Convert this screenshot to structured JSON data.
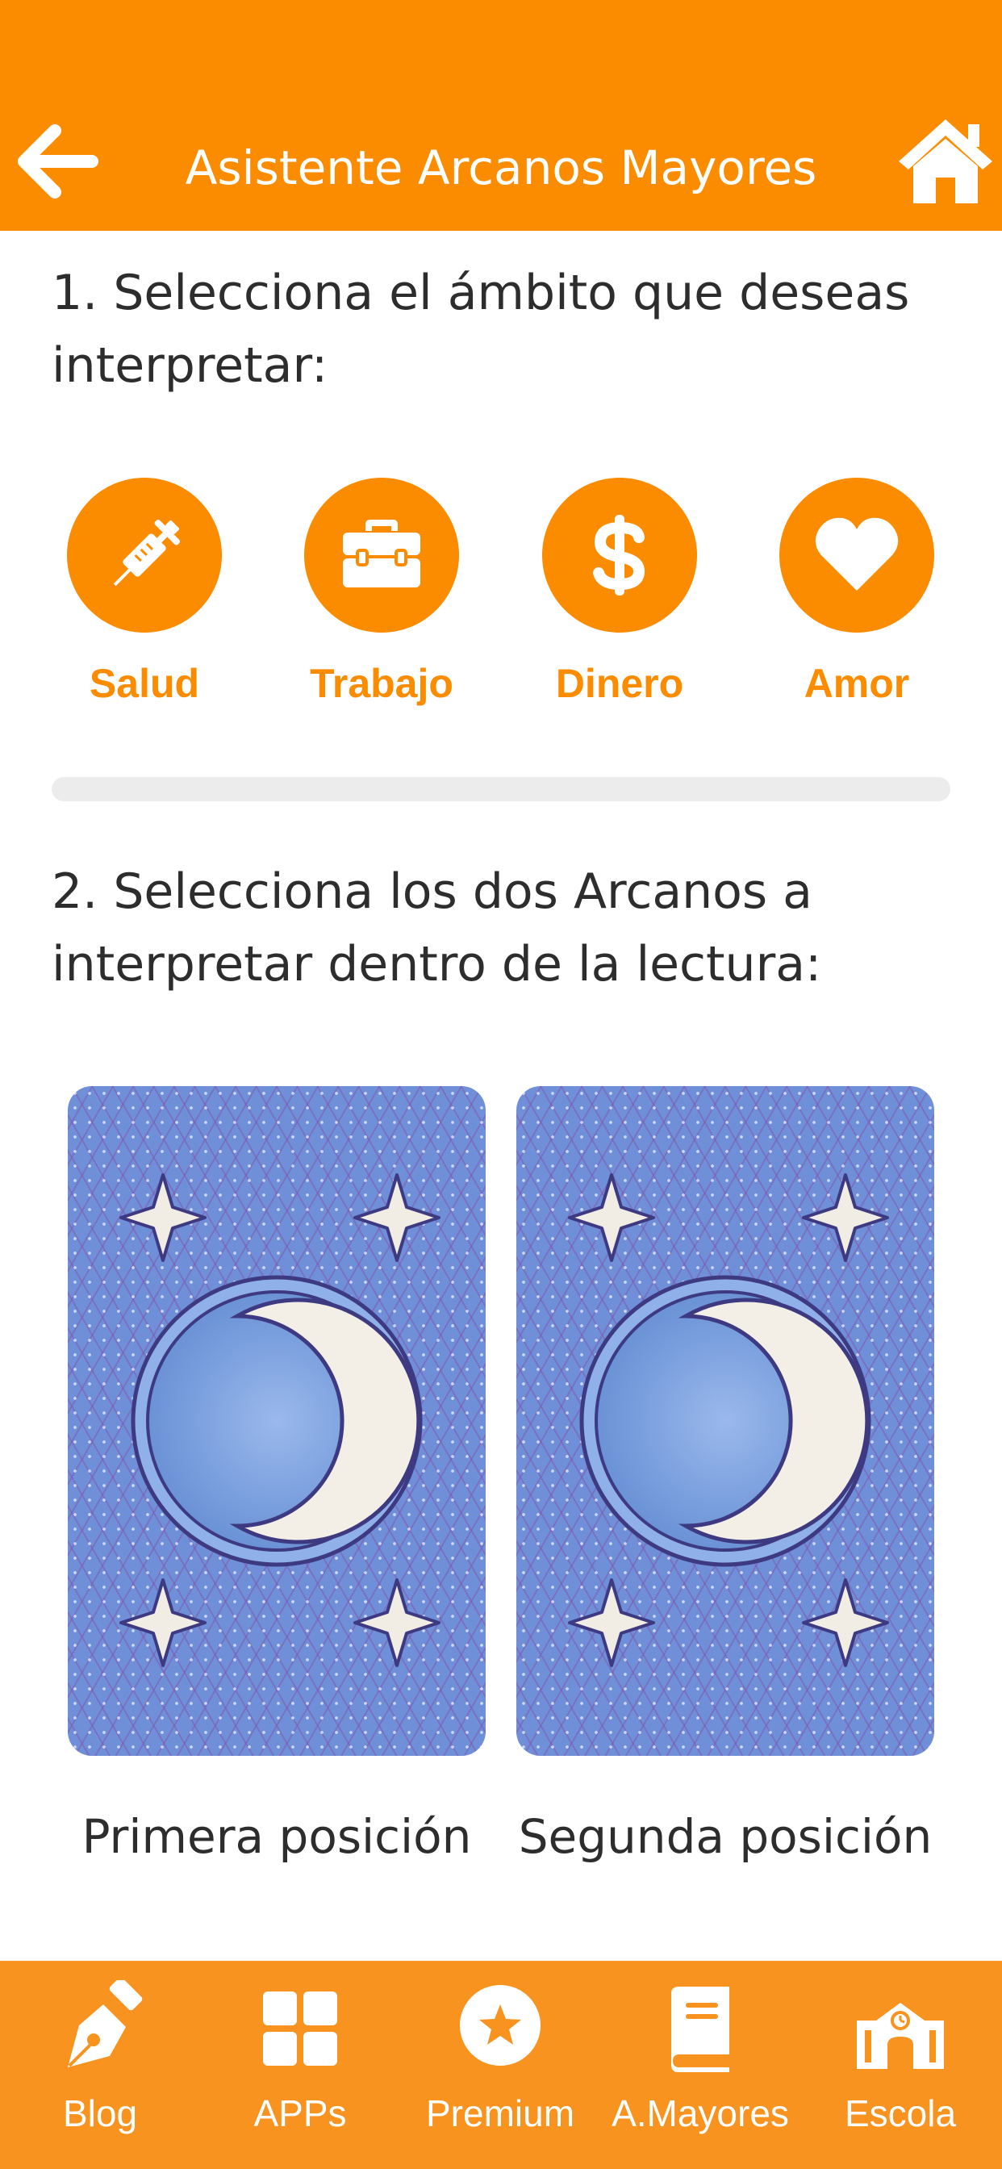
{
  "header": {
    "title": "Asistente Arcanos Mayores",
    "back_icon": "arrow-left-icon",
    "home_icon": "home-icon",
    "background": "#fb8c00"
  },
  "step1": {
    "text": "1. Selecciona el ámbito que deseas interpretar:"
  },
  "options": [
    {
      "label": "Salud",
      "icon": "syringe-icon"
    },
    {
      "label": "Trabajo",
      "icon": "toolbox-icon"
    },
    {
      "label": "Dinero",
      "icon": "dollar-icon"
    },
    {
      "label": "Amor",
      "icon": "heart-icon"
    }
  ],
  "step2": {
    "text": "2. Selecciona los dos Arcanos a interpretar dentro de la lectura:"
  },
  "cards": [
    {
      "position_label": "Primera posición",
      "art": "moon-stars-card-back"
    },
    {
      "position_label": "Segunda posición",
      "art": "moon-stars-card-back"
    }
  ],
  "bottom_nav": [
    {
      "label": "Blog",
      "icon": "pen-nib-icon"
    },
    {
      "label": "APPs",
      "icon": "grid-icon"
    },
    {
      "label": "Premium",
      "icon": "star-circle-icon"
    },
    {
      "label": "A.Mayores",
      "icon": "book-icon"
    },
    {
      "label": "Escola",
      "icon": "school-icon"
    }
  ],
  "colors": {
    "accent": "#fb8c00",
    "bottom_bar": "#f7931e",
    "card_blue": "#6f8fd8"
  }
}
